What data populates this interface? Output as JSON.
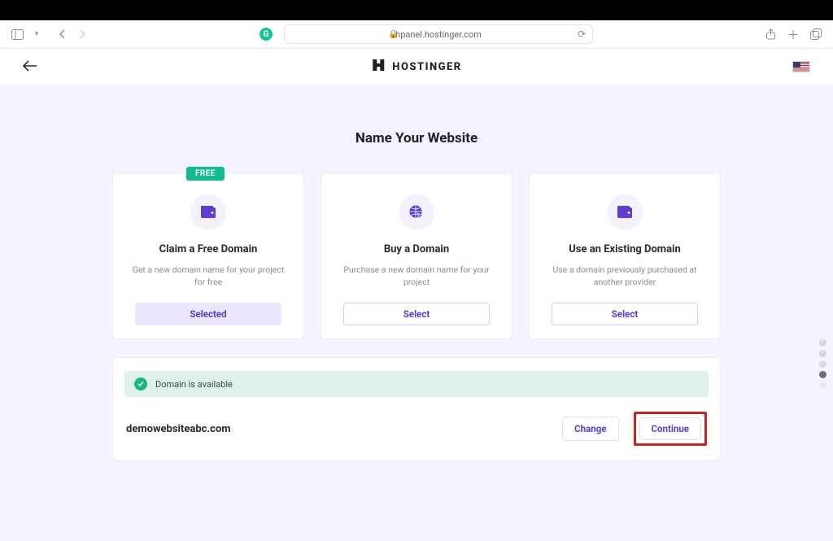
{
  "browser": {
    "url": "hpanel.hostinger.com"
  },
  "brand": {
    "name": "HOSTINGER"
  },
  "page_title": "Name Your Website",
  "cards": [
    {
      "badge": "FREE",
      "title": "Claim a Free Domain",
      "desc": "Get a new domain name for your project for free",
      "button": "Selected",
      "selected": true
    },
    {
      "title": "Buy a Domain",
      "desc": "Purchase a new domain name for your project",
      "button": "Select",
      "selected": false
    },
    {
      "title": "Use an Existing Domain",
      "desc": "Use a domain previously purchased at another provider",
      "button": "Select",
      "selected": false
    }
  ],
  "availability": {
    "message": "Domain is available"
  },
  "domain": {
    "name": "demowebsiteabc.com",
    "change_label": "Change",
    "continue_label": "Continue"
  }
}
